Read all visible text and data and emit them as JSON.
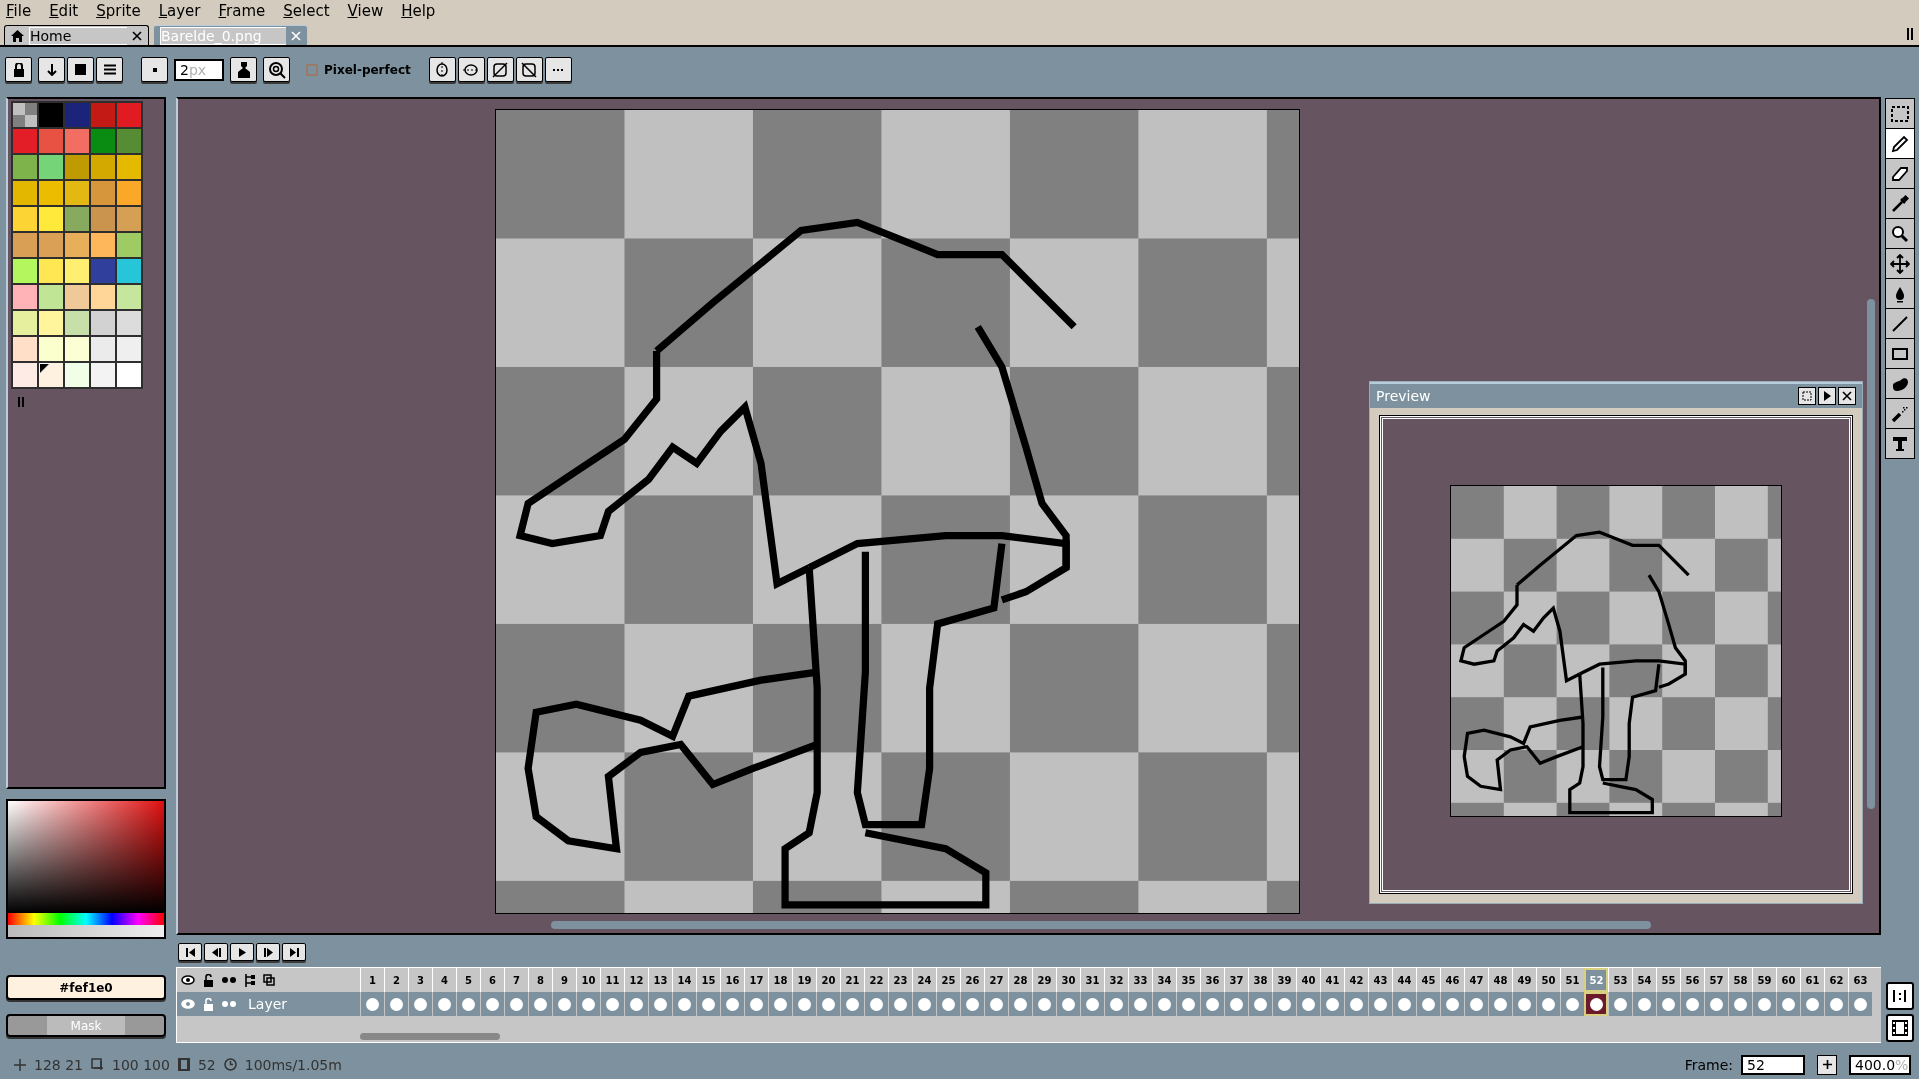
{
  "menu": [
    "File",
    "Edit",
    "Sprite",
    "Layer",
    "Frame",
    "Select",
    "View",
    "Help"
  ],
  "tabs": [
    {
      "label": "Home",
      "kind": "home",
      "selected": false
    },
    {
      "label": "Barelde_0.png",
      "kind": "file",
      "selected": true
    }
  ],
  "context_bar": {
    "brush_size": {
      "value": "2",
      "unit": "px"
    },
    "pixel_perfect": {
      "label": "Pixel-perfect",
      "checked": false
    }
  },
  "palette": [
    {
      "kind": "transparent",
      "selected": false
    },
    {
      "kind": "color",
      "color": "#000000",
      "selected": false
    },
    {
      "kind": "color",
      "color": "#1c237a",
      "selected": false
    },
    {
      "kind": "color",
      "color": "#c31a16",
      "selected": false
    },
    {
      "kind": "color",
      "color": "#e01c22",
      "selected": false
    },
    {
      "kind": "color",
      "color": "#e41e26",
      "selected": false
    },
    {
      "kind": "color",
      "color": "#e85243",
      "selected": false
    },
    {
      "kind": "color",
      "color": "#f26d62",
      "selected": false
    },
    {
      "kind": "color",
      "color": "#0a8c12",
      "selected": false
    },
    {
      "kind": "color",
      "color": "#568c33",
      "selected": false
    },
    {
      "kind": "color",
      "color": "#7db34a",
      "selected": false
    },
    {
      "kind": "color",
      "color": "#75d477",
      "selected": false
    },
    {
      "kind": "color",
      "color": "#bf9a00",
      "selected": false
    },
    {
      "kind": "color",
      "color": "#d3a900",
      "selected": false
    },
    {
      "kind": "color",
      "color": "#e5b900",
      "selected": false
    },
    {
      "kind": "color",
      "color": "#e3b700",
      "selected": false
    },
    {
      "kind": "color",
      "color": "#ecbc00",
      "selected": false
    },
    {
      "kind": "color",
      "color": "#e4b812",
      "selected": false
    },
    {
      "kind": "color",
      "color": "#d6963c",
      "selected": false
    },
    {
      "kind": "color",
      "color": "#f9a828",
      "selected": false
    },
    {
      "kind": "color",
      "color": "#fcd535",
      "selected": false
    },
    {
      "kind": "color",
      "color": "#ffe93b",
      "selected": false
    },
    {
      "kind": "color",
      "color": "#88aa5e",
      "selected": false
    },
    {
      "kind": "color",
      "color": "#ca944e",
      "selected": false
    },
    {
      "kind": "color",
      "color": "#d5a054",
      "selected": false
    },
    {
      "kind": "color",
      "color": "#d9a055",
      "selected": false
    },
    {
      "kind": "color",
      "color": "#daa156",
      "selected": false
    },
    {
      "kind": "color",
      "color": "#e8af5b",
      "selected": false
    },
    {
      "kind": "color",
      "color": "#ffb75b",
      "selected": false
    },
    {
      "kind": "color",
      "color": "#9ecb63",
      "selected": false
    },
    {
      "kind": "color",
      "color": "#b3f65e",
      "selected": false
    },
    {
      "kind": "color",
      "color": "#ffe753",
      "selected": false
    },
    {
      "kind": "color",
      "color": "#ffef70",
      "selected": false
    },
    {
      "kind": "color",
      "color": "#313f9c",
      "selected": false
    },
    {
      "kind": "color",
      "color": "#26c5d9",
      "selected": false
    },
    {
      "kind": "color",
      "color": "#ffb3b6",
      "selected": false
    },
    {
      "kind": "color",
      "color": "#c0e595",
      "selected": false
    },
    {
      "kind": "color",
      "color": "#f0c999",
      "selected": false
    },
    {
      "kind": "color",
      "color": "#ffd698",
      "selected": false
    },
    {
      "kind": "color",
      "color": "#c6e59d",
      "selected": false
    },
    {
      "kind": "color",
      "color": "#e5ef9d",
      "selected": false
    },
    {
      "kind": "color",
      "color": "#fff59c",
      "selected": false
    },
    {
      "kind": "color",
      "color": "#c7e0a9",
      "selected": false
    },
    {
      "kind": "color",
      "color": "#d2d2d2",
      "selected": false
    },
    {
      "kind": "color",
      "color": "#dcdcdc",
      "selected": false
    },
    {
      "kind": "color",
      "color": "#ffdfc8",
      "selected": false
    },
    {
      "kind": "color",
      "color": "#fbffcd",
      "selected": false
    },
    {
      "kind": "color",
      "color": "#fbffd3",
      "selected": false
    },
    {
      "kind": "color",
      "color": "#ebebeb",
      "selected": false
    },
    {
      "kind": "color",
      "color": "#efefef",
      "selected": false
    },
    {
      "kind": "color",
      "color": "#ffebe6",
      "selected": false
    },
    {
      "kind": "color",
      "color": "#fef1e0",
      "selected": true
    },
    {
      "kind": "color",
      "color": "#f2ffe8",
      "selected": false
    },
    {
      "kind": "color",
      "color": "#f3f3f3",
      "selected": false
    },
    {
      "kind": "color",
      "color": "#ffffff",
      "selected": false
    }
  ],
  "color_field": {
    "value": "#fef1e0"
  },
  "mask_button": "Mask",
  "preview": {
    "title": "Preview"
  },
  "tools": [
    {
      "selected": false
    },
    {
      "selected": true
    },
    {
      "selected": false
    },
    {
      "selected": false
    },
    {
      "selected": false
    },
    {
      "selected": false
    },
    {
      "selected": false
    },
    {
      "selected": false
    },
    {
      "selected": false
    },
    {
      "selected": false
    },
    {
      "selected": false
    },
    {
      "selected": false
    }
  ],
  "timeline": {
    "layer": "Layer",
    "frames": [
      {
        "label": "1",
        "selected": false
      },
      {
        "label": "2",
        "selected": false
      },
      {
        "label": "3",
        "selected": false
      },
      {
        "label": "4",
        "selected": false
      },
      {
        "label": "5",
        "selected": false
      },
      {
        "label": "6",
        "selected": false
      },
      {
        "label": "7",
        "selected": false
      },
      {
        "label": "8",
        "selected": false
      },
      {
        "label": "9",
        "selected": false
      },
      {
        "label": "10",
        "selected": false
      },
      {
        "label": "11",
        "selected": false
      },
      {
        "label": "12",
        "selected": false
      },
      {
        "label": "13",
        "selected": false
      },
      {
        "label": "14",
        "selected": false
      },
      {
        "label": "15",
        "selected": false
      },
      {
        "label": "16",
        "selected": false
      },
      {
        "label": "17",
        "selected": false
      },
      {
        "label": "18",
        "selected": false
      },
      {
        "label": "19",
        "selected": false
      },
      {
        "label": "20",
        "selected": false
      },
      {
        "label": "21",
        "selected": false
      },
      {
        "label": "22",
        "selected": false
      },
      {
        "label": "23",
        "selected": false
      },
      {
        "label": "24",
        "selected": false
      },
      {
        "label": "25",
        "selected": false
      },
      {
        "label": "26",
        "selected": false
      },
      {
        "label": "27",
        "selected": false
      },
      {
        "label": "28",
        "selected": false
      },
      {
        "label": "29",
        "selected": false
      },
      {
        "label": "30",
        "selected": false
      },
      {
        "label": "31",
        "selected": false
      },
      {
        "label": "32",
        "selected": false
      },
      {
        "label": "33",
        "selected": false
      },
      {
        "label": "34",
        "selected": false
      },
      {
        "label": "35",
        "selected": false
      },
      {
        "label": "36",
        "selected": false
      },
      {
        "label": "37",
        "selected": false
      },
      {
        "label": "38",
        "selected": false
      },
      {
        "label": "39",
        "selected": false
      },
      {
        "label": "40",
        "selected": false
      },
      {
        "label": "41",
        "selected": false
      },
      {
        "label": "42",
        "selected": false
      },
      {
        "label": "43",
        "selected": false
      },
      {
        "label": "44",
        "selected": false
      },
      {
        "label": "45",
        "selected": false
      },
      {
        "label": "46",
        "selected": false
      },
      {
        "label": "47",
        "selected": false
      },
      {
        "label": "48",
        "selected": false
      },
      {
        "label": "49",
        "selected": false
      },
      {
        "label": "50",
        "selected": false
      },
      {
        "label": "51",
        "selected": false
      },
      {
        "label": "52",
        "selected": true
      },
      {
        "label": "53",
        "selected": false
      },
      {
        "label": "54",
        "selected": false
      },
      {
        "label": "55",
        "selected": false
      },
      {
        "label": "56",
        "selected": false
      },
      {
        "label": "57",
        "selected": false
      },
      {
        "label": "58",
        "selected": false
      },
      {
        "label": "59",
        "selected": false
      },
      {
        "label": "60",
        "selected": false
      },
      {
        "label": "61",
        "selected": false
      },
      {
        "label": "62",
        "selected": false
      },
      {
        "label": "63",
        "selected": false
      }
    ]
  },
  "status_bar": {
    "position": "128 21",
    "size": "100 100",
    "frames": "52",
    "duration": "100ms/1.05m",
    "frame_label": "Frame:",
    "frame_value": "52",
    "zoom_value": "400.0",
    "zoom_unit": "%"
  }
}
